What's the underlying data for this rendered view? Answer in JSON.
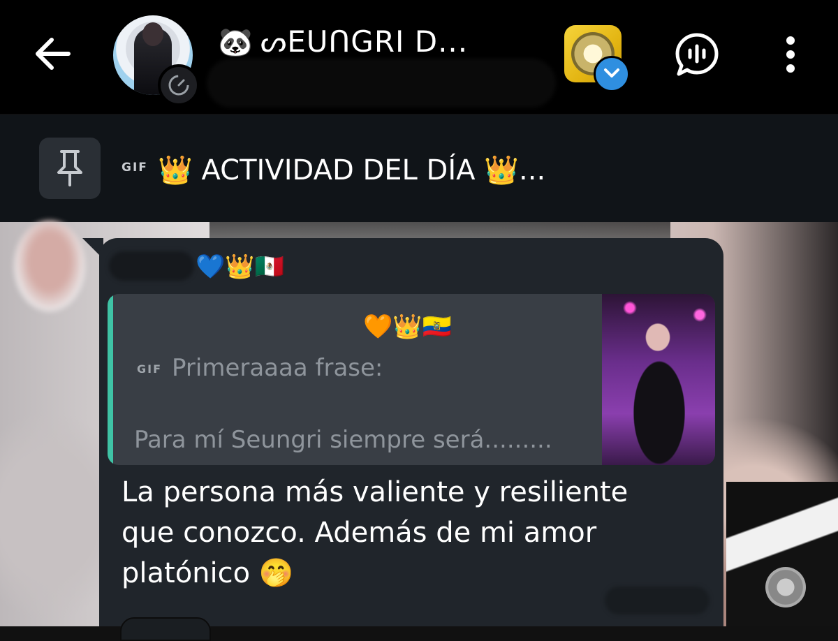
{
  "header": {
    "back_label": "Back",
    "chat_title_icon": "🐼",
    "chat_title": "ᔕEUᑎGRI D...",
    "avatar_badge_icon": "timer-icon",
    "group_badge_icon": "chevron-down-icon",
    "voice_chat_icon": "voice-chat-icon",
    "more_icon": "more-vertical-icon",
    "accent_color": "#2f8fe0"
  },
  "pinned": {
    "icon": "pin-icon",
    "gif_tag": "GIF",
    "text": "👑 ACTIVIDAD DEL DÍA 👑..."
  },
  "message": {
    "sender_emojis": "💙👑🇲🇽",
    "quote": {
      "emojis": "🧡👑🇪🇨",
      "gif_tag": "GIF",
      "line1": "Primeraaaa frase:",
      "line2": "Para mí Seungri siempre será.........",
      "accent_color": "#3fc3a5"
    },
    "text": "La persona más valiente y resiliente que conozco. Además de mi amor platónico 🤭"
  }
}
